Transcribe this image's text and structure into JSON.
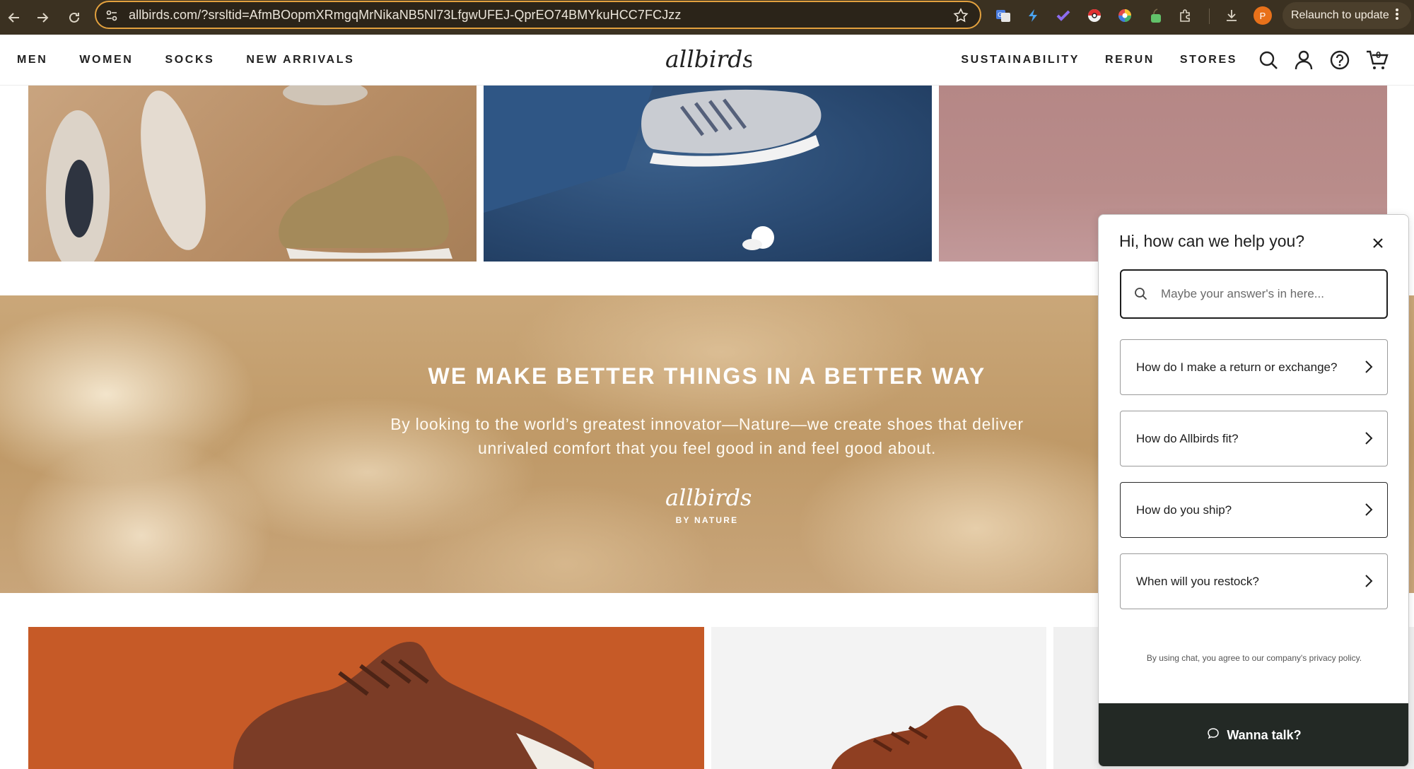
{
  "browser": {
    "url": "allbirds.com/?srsltid=AfmBOopmXRmgqMrNikaNB5Nl73LfgwUFEJ-QprEO74BMYkuHCC7FCJzz",
    "profile_initial": "P",
    "relaunch_label": "Relaunch to update"
  },
  "header": {
    "logo_text": "allbirds",
    "nav_left": [
      "MEN",
      "WOMEN",
      "SOCKS",
      "NEW ARRIVALS"
    ],
    "nav_right": [
      "SUSTAINABILITY",
      "RERUN",
      "STORES"
    ],
    "cart_count": "0"
  },
  "banner": {
    "title": "WE MAKE BETTER THINGS IN A BETTER WAY",
    "body_line1": "By looking to the world’s greatest innovator—Nature—we create shoes that deliver",
    "body_line2": "unrivaled comfort that you feel good in and feel good about.",
    "logo_text": "allbirds",
    "logo_sub": "BY NATURE"
  },
  "chat": {
    "title": "Hi, how can we help you?",
    "search_placeholder": "Maybe your answer's in here...",
    "faqs": [
      "How do I make a return or exchange?",
      "How do Allbirds fit?",
      "How do you ship?",
      "When will you restock?"
    ],
    "privacy": "By using chat, you agree to our company's privacy policy.",
    "cta_label": "Wanna talk?"
  },
  "colors": {
    "chrome_bg": "#3b3121",
    "url_border": "#e3a13e",
    "chat_cta_bg": "#232925",
    "banner_bg": "#c4a072"
  },
  "icons": [
    "back-arrow-icon",
    "forward-arrow-icon",
    "reload-icon",
    "site-settings-icon",
    "bookmark-star-icon",
    "download-icon",
    "search-icon",
    "account-icon",
    "help-icon",
    "cart-icon",
    "close-icon",
    "chevron-right-icon",
    "chat-bubble-icon"
  ]
}
